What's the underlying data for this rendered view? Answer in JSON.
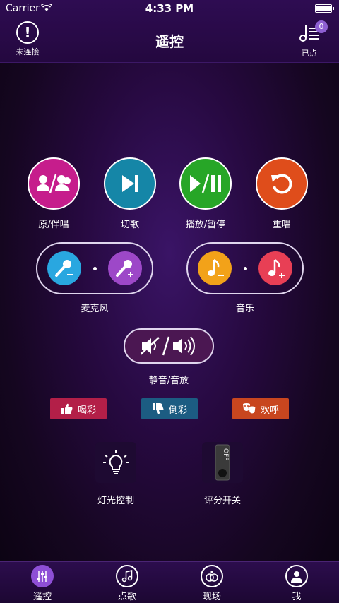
{
  "status_bar": {
    "carrier": "Carrier",
    "time": "4:33 PM"
  },
  "nav": {
    "title": "遥控",
    "left_icon": "exclamation-circle-icon",
    "left_label": "未连接",
    "right_icon": "playlist-icon",
    "right_label": "已点",
    "badge_count": "0"
  },
  "controls": [
    {
      "label": "原/伴唱",
      "icon": "vocal-switch-icon",
      "color": "#c61d8c"
    },
    {
      "label": "切歌",
      "icon": "skip-next-icon",
      "color": "#1586a7"
    },
    {
      "label": "播放/暂停",
      "icon": "play-pause-icon",
      "color": "#27a627"
    },
    {
      "label": "重唱",
      "icon": "replay-icon",
      "color": "#df4d1b"
    }
  ],
  "mic": {
    "label": "麦克风",
    "down_color": "#29a7e0",
    "up_color": "#9d48c8"
  },
  "music": {
    "label": "音乐",
    "down_color": "#f2a219",
    "up_color": "#e83f55"
  },
  "mute": {
    "label": "静音/音放",
    "icon": "mute-volume-icon"
  },
  "reactions": [
    {
      "label": "喝彩",
      "icon": "thumbs-up-icon",
      "color": "#b31f48"
    },
    {
      "label": "倒彩",
      "icon": "thumbs-down-icon",
      "color": "#1c5c82"
    },
    {
      "label": "欢呼",
      "icon": "masks-icon",
      "color": "#c8461f"
    }
  ],
  "light": {
    "label": "灯光控制",
    "icon": "lightbulb-icon"
  },
  "score": {
    "label": "评分开关",
    "icon": "toggle-off-icon",
    "switch_text": "OFF"
  },
  "tabs": [
    {
      "label": "遥控",
      "icon": "sliders-icon",
      "active": true
    },
    {
      "label": "点歌",
      "icon": "music-note-icon"
    },
    {
      "label": "现场",
      "icon": "rings-icon"
    },
    {
      "label": "我",
      "icon": "user-icon"
    }
  ]
}
